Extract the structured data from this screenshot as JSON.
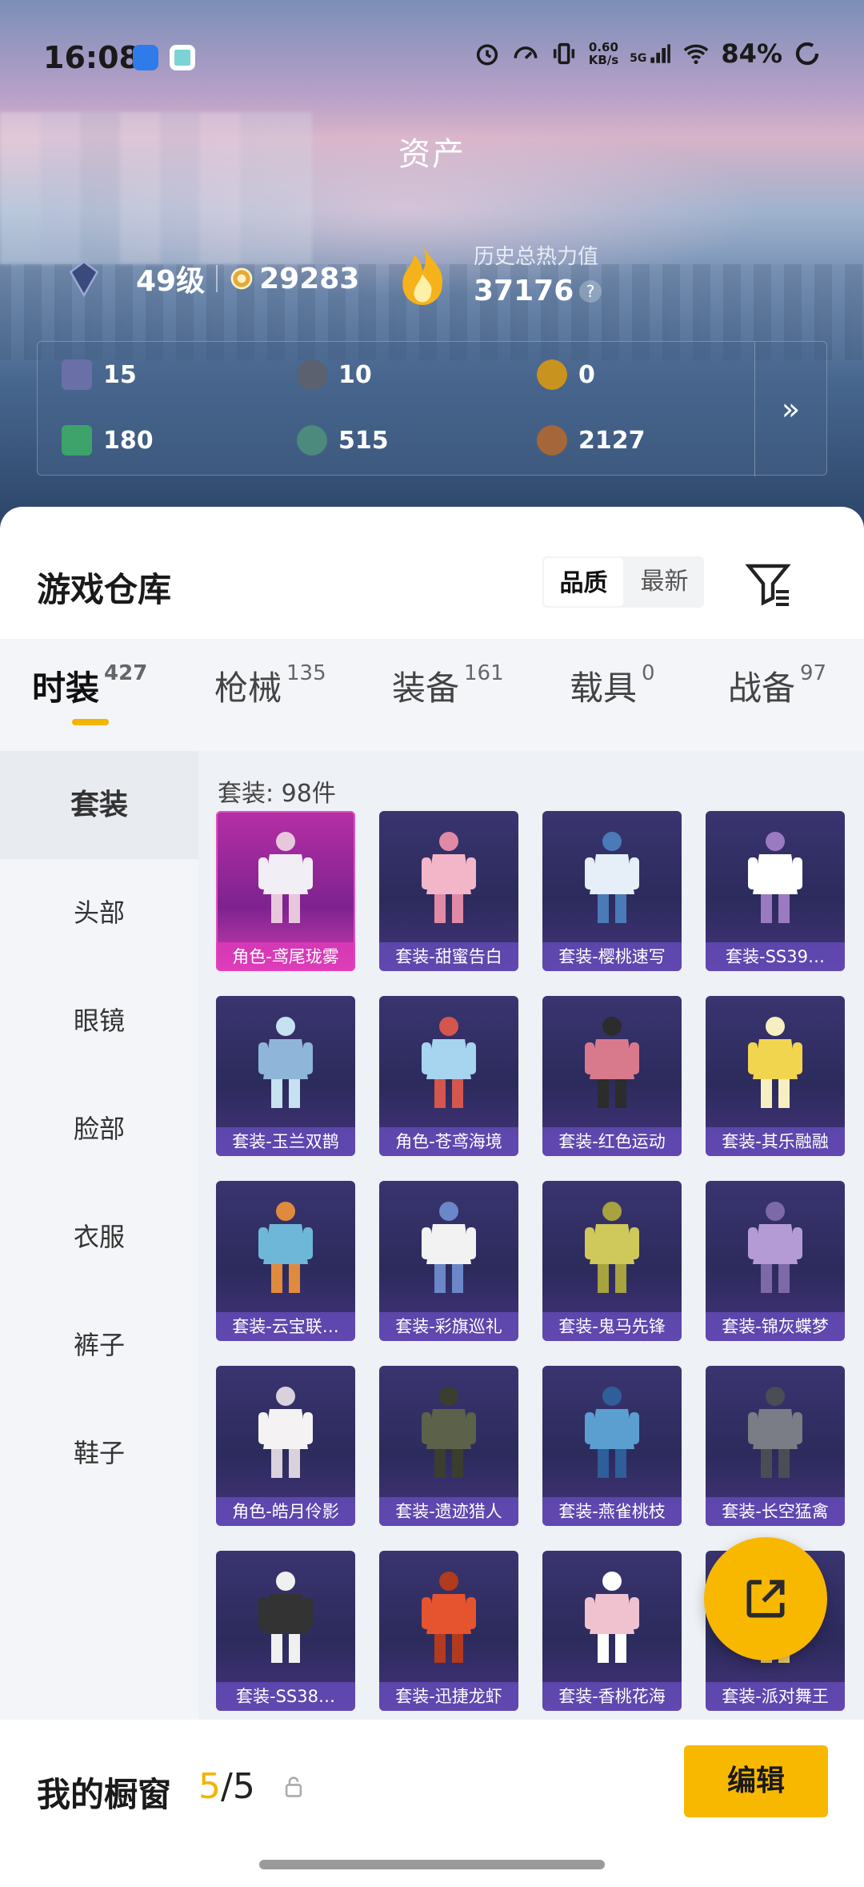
{
  "status_bar": {
    "time": "16:08",
    "net_speed": "0.60",
    "net_unit": "KB/s",
    "network": "5G",
    "battery": "84%"
  },
  "header": {
    "title": "资产",
    "level": "49级",
    "points": "29283",
    "heat_label": "历史总热力值",
    "heat_value": "37176",
    "help": "?"
  },
  "resources": [
    {
      "value": "15",
      "icon": "card-icon",
      "color": "#6b6fa8"
    },
    {
      "value": "10",
      "icon": "token-icon",
      "color": "#5c6170"
    },
    {
      "value": "0",
      "icon": "gold-coin-icon",
      "color": "#c8931e"
    },
    {
      "value": "180",
      "icon": "ticket-icon",
      "color": "#3da36a"
    },
    {
      "value": "515",
      "icon": "gem-icon",
      "color": "#4b8a7c"
    },
    {
      "value": "2127",
      "icon": "bronze-coin-icon",
      "color": "#a5673a"
    }
  ],
  "resources_more": "»",
  "warehouse": {
    "title": "游戏仓库",
    "sort_options": [
      "品质",
      "最新"
    ]
  },
  "tabs": [
    {
      "label": "时装",
      "count": "427"
    },
    {
      "label": "枪械",
      "count": "135"
    },
    {
      "label": "装备",
      "count": "161"
    },
    {
      "label": "载具",
      "count": "0"
    },
    {
      "label": "战备",
      "count": "97"
    }
  ],
  "side_menu": [
    "套装",
    "头部",
    "眼镜",
    "脸部",
    "衣服",
    "裤子",
    "鞋子"
  ],
  "count_label": "套装: 98件",
  "items": [
    {
      "label": "角色-鸢尾珑雾",
      "color": "#f2eef5",
      "accent": "#e8c7dc"
    },
    {
      "label": "套装-甜蜜告白",
      "color": "#f3b6c9",
      "accent": "#e08aa6"
    },
    {
      "label": "套装-樱桃速写",
      "color": "#e6eef7",
      "accent": "#4a7ab8"
    },
    {
      "label": "套装-SS39…",
      "color": "#ffffff",
      "accent": "#9a7ac0"
    },
    {
      "label": "套装-玉兰双鹊",
      "color": "#8fb6d8",
      "accent": "#c6e1ef"
    },
    {
      "label": "角色-苍鸢海境",
      "color": "#a7d4ee",
      "accent": "#d4564d"
    },
    {
      "label": "套装-红色运动",
      "color": "#d87a8c",
      "accent": "#2c2c2c"
    },
    {
      "label": "套装-其乐融融",
      "color": "#f2d54e",
      "accent": "#f7eec1"
    },
    {
      "label": "套装-云宝联…",
      "color": "#6fb7d8",
      "accent": "#e08a3e"
    },
    {
      "label": "套装-彩旗巡礼",
      "color": "#f2f2f2",
      "accent": "#6b86c9"
    },
    {
      "label": "套装-鬼马先锋",
      "color": "#cfc85a",
      "accent": "#a8a23f"
    },
    {
      "label": "套装-锦灰蝶梦",
      "color": "#b49bd6",
      "accent": "#7d68a8"
    },
    {
      "label": "角色-皓月伶影",
      "color": "#f4f2f2",
      "accent": "#d9d2dc"
    },
    {
      "label": "套装-遗迹猎人",
      "color": "#5c6149",
      "accent": "#3b3d2f"
    },
    {
      "label": "套装-燕雀桃枝",
      "color": "#5b9fd0",
      "accent": "#2f5e9a"
    },
    {
      "label": "套装-长空猛禽",
      "color": "#7a7d85",
      "accent": "#4a4d55"
    },
    {
      "label": "套装-SS38…",
      "color": "#333333",
      "accent": "#f0f0f0"
    },
    {
      "label": "套装-迅捷龙虾",
      "color": "#e5542e",
      "accent": "#b23a1e"
    },
    {
      "label": "套装-香桃花海",
      "color": "#f0c2d0",
      "accent": "#ffffff"
    },
    {
      "label": "套装-派对舞王",
      "color": "#d8a92e",
      "accent": "#f2d36a"
    }
  ],
  "showcase": {
    "label": "我的橱窗",
    "current": "5",
    "sep": "/",
    "total": "5"
  },
  "edit_label": "编辑",
  "colors": {
    "accent": "#f8b800",
    "underline": "#f5b400"
  }
}
